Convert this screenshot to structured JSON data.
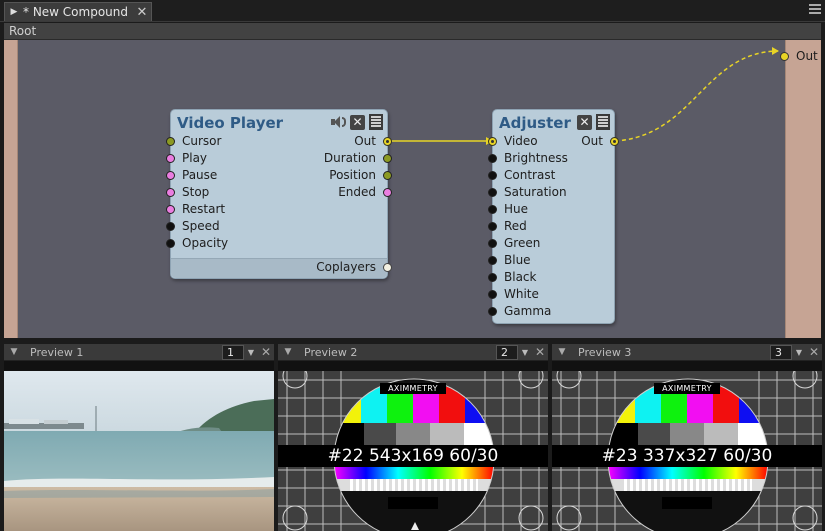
{
  "tab": {
    "title": "* New Compound"
  },
  "breadcrumb": "Root",
  "compound": {
    "out_label": "Out"
  },
  "video_player": {
    "title": "Video Player",
    "inputs": [
      "Cursor",
      "Play",
      "Pause",
      "Stop",
      "Restart",
      "Speed",
      "Opacity"
    ],
    "outputs": [
      "Out",
      "Duration",
      "Position",
      "Ended"
    ],
    "footer_output": "Coplayers"
  },
  "adjuster": {
    "title": "Adjuster",
    "inputs": [
      "Video",
      "Brightness",
      "Contrast",
      "Saturation",
      "Hue",
      "Red",
      "Green",
      "Blue",
      "Black",
      "White",
      "Gamma"
    ],
    "output": "Out"
  },
  "previews": [
    {
      "name": "Preview 1",
      "number": "1"
    },
    {
      "name": "Preview 2",
      "number": "2",
      "brand": "AXIMMETRY",
      "overlay": "#22 543x169 60/30"
    },
    {
      "name": "Preview 3",
      "number": "3",
      "brand": "AXIMMETRY",
      "overlay": "#23 337x327 60/30"
    }
  ],
  "colors": {
    "graph_bg": "#5b5b66",
    "node_bg": "#b9ccd9",
    "node_title": "#2f5b86",
    "wire_video": "#e8d426",
    "port_pink": "#ea7ee0",
    "port_olive": "#8c9a22"
  },
  "icons": [
    "tab-arrow-icon",
    "close-icon",
    "menu-icon",
    "speaker-icon",
    "list-icon",
    "collapse-icon",
    "chevron-down-icon"
  ]
}
